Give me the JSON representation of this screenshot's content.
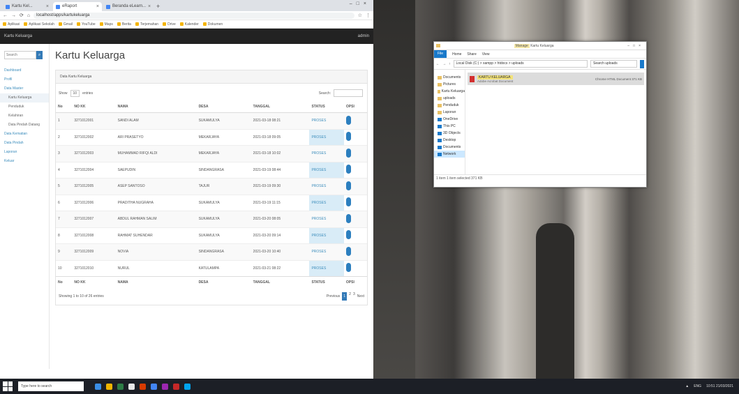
{
  "browser": {
    "tabs": [
      {
        "label": "Kartu Kel..."
      },
      {
        "label": "eRaport"
      },
      {
        "label": "Beranda eLearn..."
      }
    ],
    "new_tab": "+",
    "address": "localhost/apps/kartukeluarga",
    "bookmarks": [
      "Aplikasi",
      "Aplikasi Sekolah",
      "Gmail",
      "YouTube",
      "Maps",
      "Berita",
      "Terjemahan",
      "Drive",
      "Kalender",
      "Dokumen"
    ]
  },
  "app": {
    "header_left": "Kartu Keluarga",
    "header_right": "admin",
    "search_placeholder": "Search",
    "sidebar": [
      {
        "label": "Dashboard",
        "sub": false,
        "active": false
      },
      {
        "label": "Profil",
        "sub": false,
        "active": false
      },
      {
        "label": "Data Master",
        "sub": false,
        "active": false
      },
      {
        "label": "Kartu Keluarga",
        "sub": true,
        "active": true
      },
      {
        "label": "Penduduk",
        "sub": true,
        "active": false
      },
      {
        "label": "Kelahiran",
        "sub": true,
        "active": false
      },
      {
        "label": "Data Pindah Datang",
        "sub": true,
        "active": false
      },
      {
        "label": "Data Kematian",
        "sub": false,
        "active": false
      },
      {
        "label": "Data Pindah",
        "sub": false,
        "active": false
      },
      {
        "label": "Laporan",
        "sub": false,
        "active": false
      },
      {
        "label": "Keluar",
        "sub": false,
        "active": false
      }
    ],
    "page_title": "Kartu Keluarga",
    "panel_heading": "Data Kartu Keluarga",
    "show_label": "Show",
    "show_value": "10",
    "entries_label": "entries",
    "search_label": "Search:",
    "columns": [
      "No",
      "NO KK",
      "NAMA",
      "DESA",
      "TANGGAL",
      "STATUS",
      "OPSI"
    ],
    "rows": [
      [
        "1",
        "3271012001",
        "SANDI ALAM",
        "SUKAMULYA",
        "2021-03-18 08:21",
        "PROSES"
      ],
      [
        "2",
        "3271012002",
        "ARI PRASETYO",
        "MEKARJAYA",
        "2021-03-18 09:05",
        "PROSES"
      ],
      [
        "3",
        "3271012003",
        "MUHAMMAD RIFQI ALDI",
        "MEKARJAYA",
        "2021-03-18 10:02",
        "PROSES"
      ],
      [
        "4",
        "3271012004",
        "SAEPUDIN",
        "SINDANGRASA",
        "2021-03-19 08:44",
        "PROSES"
      ],
      [
        "5",
        "3271012005",
        "ASEP SANTOSO",
        "TAJUR",
        "2021-03-19 09:30",
        "PROSES"
      ],
      [
        "6",
        "3271012006",
        "PRADITHA NUGRAHA",
        "SUKAMULYA",
        "2021-03-19 11:15",
        "PROSES"
      ],
      [
        "7",
        "3271012007",
        "ABDUL RAHMAN SALIM",
        "SUKAMULYA",
        "2021-03-20 08:05",
        "PROSES"
      ],
      [
        "8",
        "3271012008",
        "RAHMAT SUHENDAR",
        "SUKAMULYA",
        "2021-03-20 09:14",
        "PROSES"
      ],
      [
        "9",
        "3271012009",
        "NOVIA",
        "SINDANGRASA",
        "2021-03-20 10:40",
        "PROSES"
      ],
      [
        "10",
        "3271012010",
        "NURUL",
        "KATULAMPA",
        "2021-03-21 08:22",
        "PROSES"
      ]
    ],
    "info": "Showing 1 to 10 of 26 entries",
    "pagination": {
      "previous": "Previous",
      "pages": [
        "1",
        "2",
        "3"
      ],
      "active": "1",
      "next": "Next"
    }
  },
  "explorer": {
    "title": "Kartu Keluarga",
    "title_prefix": "Manage",
    "ribbon": [
      "File",
      "Home",
      "Share",
      "View"
    ],
    "path": "Local Disk (C:) > xampp > htdocs > uploads",
    "search": "Search uploads",
    "nav": [
      {
        "label": "Documents",
        "icon": "folder"
      },
      {
        "label": "Pictures",
        "icon": "folder"
      },
      {
        "label": "Kartu Keluarga",
        "icon": "folder"
      },
      {
        "label": "uploads",
        "icon": "folder"
      },
      {
        "label": "Penduduk",
        "icon": "folder"
      },
      {
        "label": "Laporan",
        "icon": "folder"
      },
      {
        "label": "OneDrive",
        "icon": "drive"
      },
      {
        "label": "This PC",
        "icon": "drive"
      },
      {
        "label": "3D Objects",
        "icon": "drive"
      },
      {
        "label": "Desktop",
        "icon": "drive"
      },
      {
        "label": "Documents",
        "icon": "drive"
      },
      {
        "label": "Network",
        "icon": "drive"
      }
    ],
    "file": {
      "name": "KARTU KELUARGA",
      "sub": "Adobe Acrobat Document",
      "right": "Chrome HTML Document  371 KB"
    },
    "status": "1 item  1 item selected  371 KB"
  },
  "taskbar": {
    "search_placeholder": "Type here to search",
    "icons": [
      "#3a8ee6",
      "#f0b400",
      "#2d7d46",
      "#e8e8e8",
      "#d83b01",
      "#4285f4",
      "#9c27b0",
      "#c62828",
      "#00a4ef"
    ],
    "time": "10:51",
    "date": "21/03/2021",
    "lang": "ENG"
  }
}
